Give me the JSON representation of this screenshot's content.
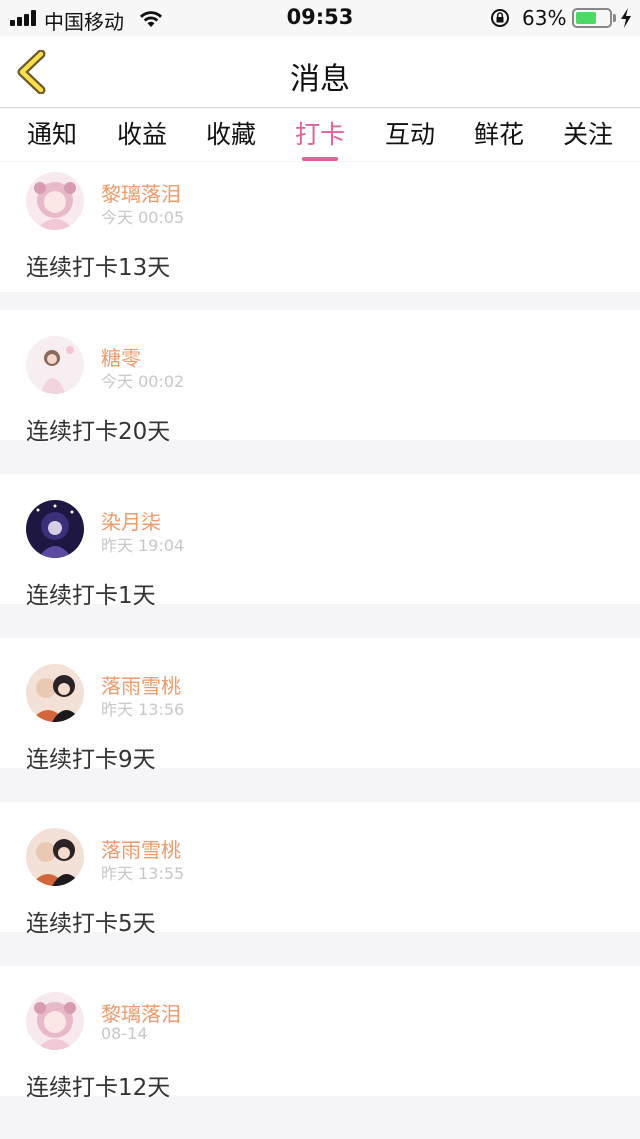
{
  "status_bar": {
    "carrier": "中国移动",
    "time": "09:53",
    "battery_percent_text": "63%",
    "battery_level": 0.63,
    "icons": [
      "signal-icon",
      "wifi-icon",
      "rotation-lock-icon",
      "battery-icon",
      "charging-icon"
    ]
  },
  "nav": {
    "back_icon": "chevron-left-icon",
    "title": "消息"
  },
  "tabs": [
    {
      "label": "通知",
      "active": false
    },
    {
      "label": "收益",
      "active": false
    },
    {
      "label": "收藏",
      "active": false
    },
    {
      "label": "打卡",
      "active": true
    },
    {
      "label": "互动",
      "active": false
    },
    {
      "label": "鲜花",
      "active": false
    },
    {
      "label": "关注",
      "active": false
    }
  ],
  "colors": {
    "accent": "#e5609a",
    "username": "#ef9a6a",
    "timestamp": "#c8c8c8",
    "page_bg": "#f5f5f7"
  },
  "messages": [
    {
      "name": "黎璃落泪",
      "time": "今天 00:05",
      "text": "连续打卡13天",
      "avatar": "anime-girl-pink-avatar"
    },
    {
      "name": "糖零",
      "time": "今天 00:02",
      "text": "连续打卡20天",
      "avatar": "girl-photo-avatar"
    },
    {
      "name": "染月柒",
      "time": "昨天 19:04",
      "text": "连续打卡1天",
      "avatar": "dark-night-anime-avatar"
    },
    {
      "name": "落雨雪桃",
      "time": "昨天 13:56",
      "text": "连续打卡9天",
      "avatar": "anime-duo-avatar"
    },
    {
      "name": "落雨雪桃",
      "time": "昨天 13:55",
      "text": "连续打卡5天",
      "avatar": "anime-duo-avatar"
    },
    {
      "name": "黎璃落泪",
      "time": "08-14",
      "text": "连续打卡12天",
      "avatar": "anime-girl-pink-avatar"
    }
  ]
}
